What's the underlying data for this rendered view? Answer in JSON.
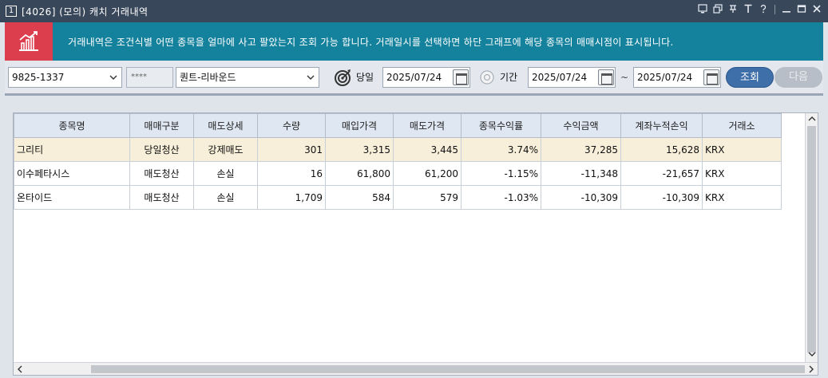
{
  "window": {
    "number": "1",
    "title": "[4026] (모의) 캐치 거래내역"
  },
  "banner": {
    "text": "거래내역은 조건식별 어떤 종목을 얼마에 사고 팔았는지 조회 가능 합니다. 거래일시를 선택하면 하단 그래프에 해당 종목의 매매시점이 표시됩니다."
  },
  "toolbar": {
    "account": "9825-1337",
    "password": "****",
    "strategy": "퀀트-리바운드",
    "today_label": "당일",
    "today_date": "2025/07/24",
    "period_label": "기간",
    "period_start": "2025/07/24",
    "tilde": "~",
    "period_end": "2025/07/24",
    "search_label": "조회",
    "next_label": "다음"
  },
  "table": {
    "headers": [
      "종목명",
      "매매구분",
      "매도상세",
      "수량",
      "매입가격",
      "매도가격",
      "종목수익률",
      "수익금액",
      "계좌누적손익",
      "거래소"
    ],
    "rows": [
      [
        "그리티",
        "당일청산",
        "강제매도",
        "301",
        "3,315",
        "3,445",
        "3.74%",
        "37,285",
        "15,628",
        "KRX"
      ],
      [
        "이수페타시스",
        "매도청산",
        "손실",
        "16",
        "61,800",
        "61,200",
        "-1.15%",
        "-11,348",
        "-21,657",
        "KRX"
      ],
      [
        "온타이드",
        "매도청산",
        "손실",
        "1,709",
        "584",
        "579",
        "-1.03%",
        "-10,309",
        "-10,309",
        "KRX"
      ]
    ]
  },
  "colors": {
    "titlebar": "#39475a",
    "banner": "#15829d",
    "banner_logo": "#dd3e4d",
    "selected_row": "#f7efd9",
    "header_bg": "#dee7f2",
    "search_button": "#3f6fa8"
  }
}
